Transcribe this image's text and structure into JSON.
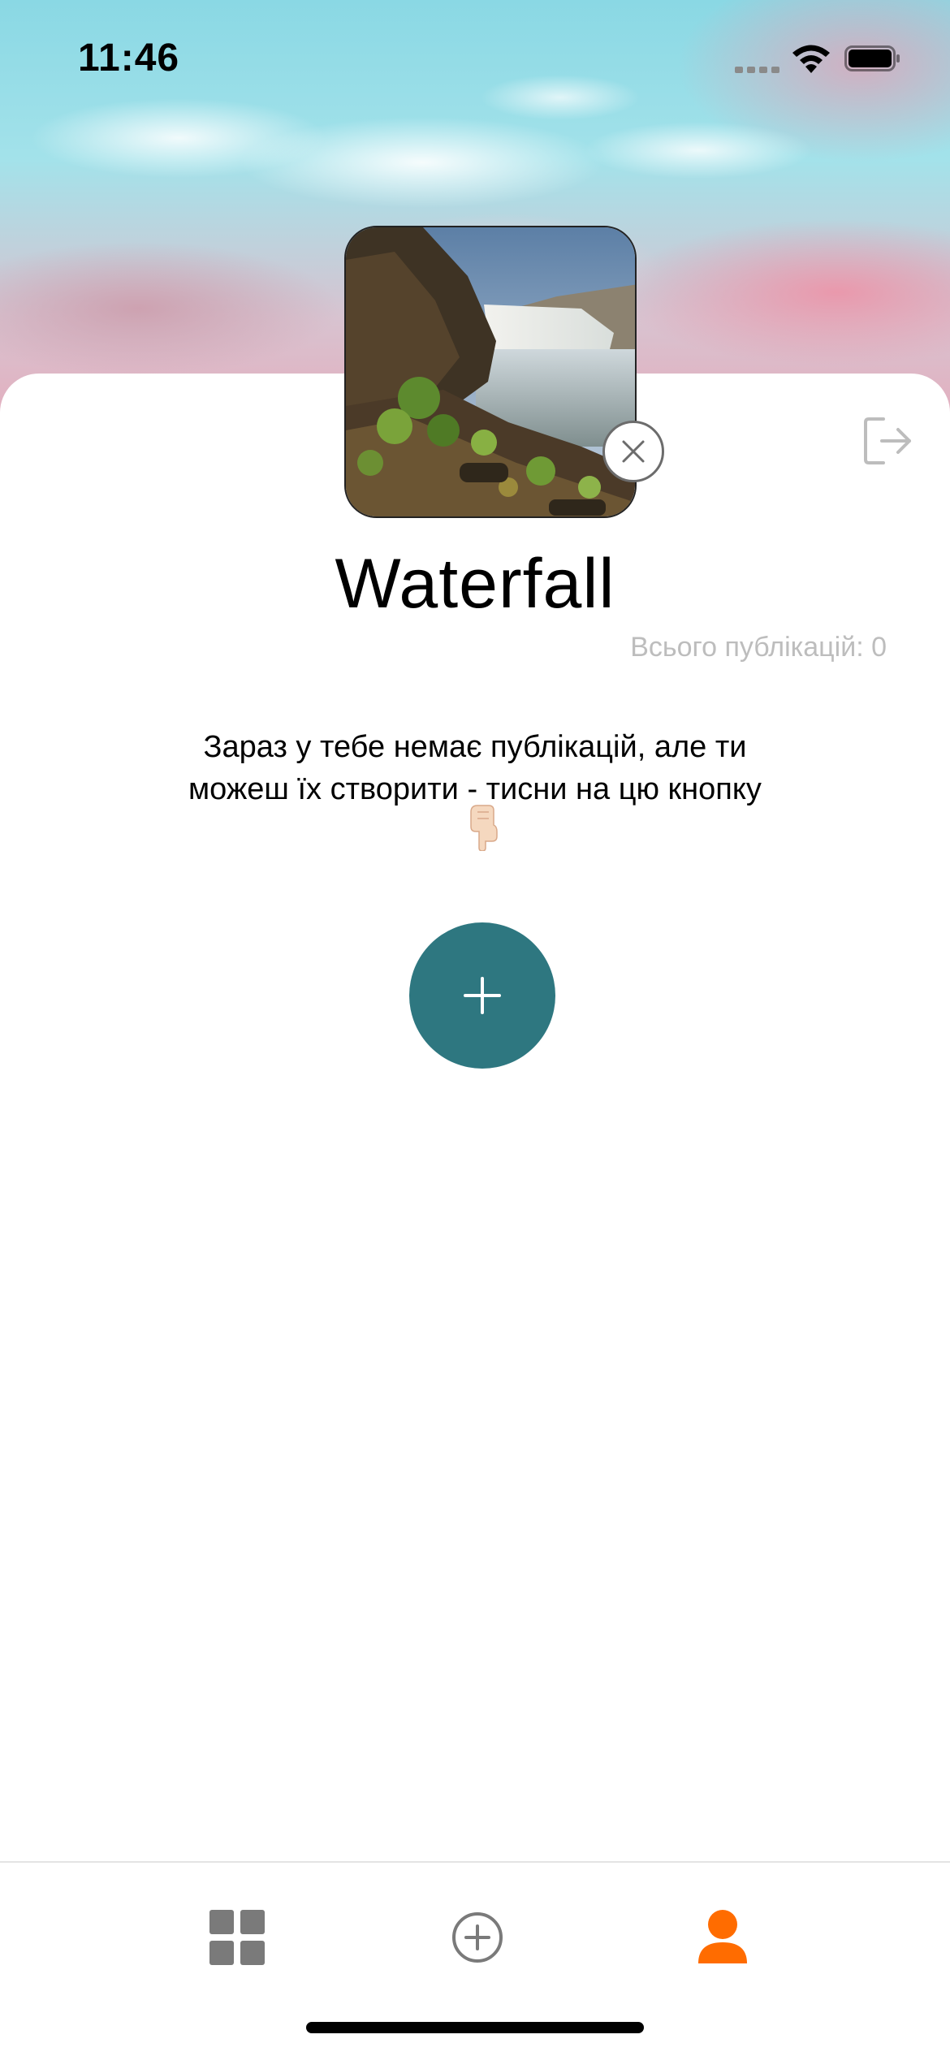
{
  "status_bar": {
    "time": "11:46",
    "icons": [
      "cellular-signal-icon",
      "wifi-icon",
      "battery-icon"
    ]
  },
  "profile": {
    "avatar": "waterfall-landscape-photo",
    "name": "Waterfall",
    "post_count_text": "Всього публікацій: 0"
  },
  "empty_state": {
    "line1": "Зараз у тебе немає публікацій, але ти",
    "line2": "можеш їх створити - тисни на цю кнопку",
    "emoji": "pointing-down-hand-emoji"
  },
  "actions": {
    "logout_icon": "logout-icon",
    "remove_avatar_icon": "close-icon",
    "add_post_icon": "plus-icon"
  },
  "tab_bar": {
    "items": [
      {
        "icon": "grid-icon",
        "active": false
      },
      {
        "icon": "add-circle-icon",
        "active": false
      },
      {
        "icon": "user-icon",
        "active": true
      }
    ],
    "active_color": "#ff6c00",
    "inactive_color": "#7a7a7a"
  },
  "colors": {
    "accent": "#2e7780",
    "secondary_text": "#bdbdbd"
  }
}
